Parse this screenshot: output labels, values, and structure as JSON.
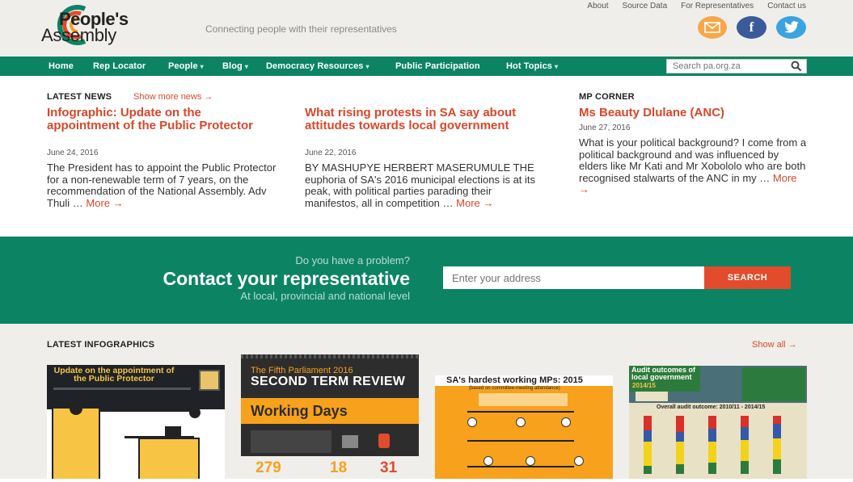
{
  "header": {
    "logo_line1": "People's",
    "logo_line2": "Assembly",
    "tagline": "Connecting people with their representatives",
    "top_links": [
      "About",
      "Source Data",
      "For Representatives",
      "Contact us"
    ],
    "social": {
      "email_icon": "email-icon",
      "facebook_glyph": "f",
      "twitter_icon": "twitter-icon"
    }
  },
  "nav": {
    "items": [
      {
        "label": "Home",
        "dropdown": false
      },
      {
        "label": "Rep Locator",
        "dropdown": false
      },
      {
        "label": "People",
        "dropdown": true
      },
      {
        "label": "Blog",
        "dropdown": true
      },
      {
        "label": "Democracy Resources",
        "dropdown": true
      },
      {
        "label": "Public Participation",
        "dropdown": false
      },
      {
        "label": "Hot Topics",
        "dropdown": true
      }
    ],
    "search_placeholder": "Search pa.org.za"
  },
  "news": {
    "label": "LATEST NEWS",
    "more_link": "Show more news →",
    "items": [
      {
        "title": "Infographic: Update on the appointment of the Public Protector",
        "date": "June 24, 2016",
        "body": "The President has to appoint the Public Protector for a non-renewable term of 7 years, on the recommendation of the National Assembly. Adv Thuli …",
        "more": "More →"
      },
      {
        "title": "What rising protests in SA say about attitudes towards local government",
        "date": "June 22, 2016",
        "body": "BY MASHUPYE HERBERT MASERUMULE THE euphoria of SA's 2016 municipal elections is at its peak, with political parties parading their manifestos, all in competition …",
        "more": "More →"
      }
    ]
  },
  "mp_corner": {
    "label": "MP CORNER",
    "title": "Ms Beauty Dlulane (ANC)",
    "date": "June 27, 2016",
    "body": "What is your political background? I come from a political background and was influenced by elders like Mr Kati and Mr Xobololo who are both recognised stalwarts of the ANC in my …",
    "more": "More →"
  },
  "contact": {
    "question": "Do you have a problem?",
    "title": "Contact your representative",
    "subtitle": "At local, provincial and national level",
    "placeholder": "Enter your address",
    "button": "SEARCH"
  },
  "infographics": {
    "label": "LATEST INFOGRAPHICS",
    "show_all": "Show all →",
    "cards": [
      {
        "title": "Update on the appointment of the Public Protector"
      },
      {
        "title_small": "The Fifth Parliament 2016",
        "title_big": "SECOND TERM REVIEW",
        "subtitle": "Working Days",
        "stats": [
          "279",
          "18",
          "31"
        ]
      },
      {
        "title": "SA's hardest working MPs: 2015",
        "subtitle": "(based on committee-meeting attendance)"
      },
      {
        "title": "Audit outcomes of local government",
        "year": "2014/15",
        "chart_title": "Overall audit outcome: 2010/11 - 2014/15"
      }
    ]
  }
}
